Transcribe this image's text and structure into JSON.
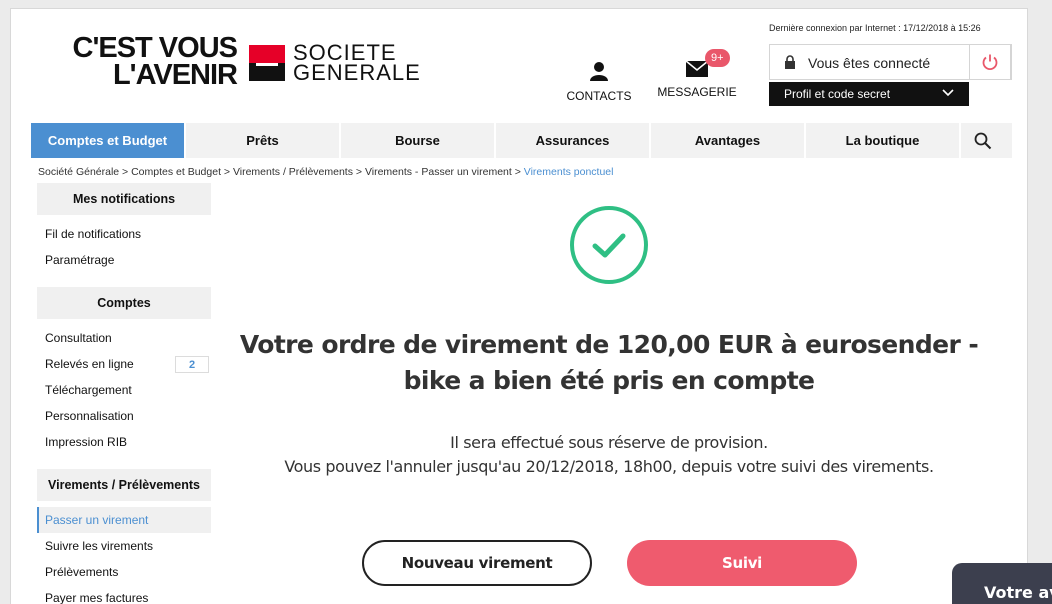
{
  "header": {
    "slogan_line1": "C'EST VOUS",
    "slogan_line2": "L'AVENIR",
    "brand_line1": "SOCIETE",
    "brand_line2": "GENERALE",
    "contacts_label": "CONTACTS",
    "messagerie_label": "MESSAGERIE",
    "messagerie_badge": "9+",
    "last_login": "Dernière connexion par Internet : 17/12/2018 à 15:26",
    "connected_label": "Vous êtes connecté",
    "profil_label": "Profil et code secret"
  },
  "nav": {
    "items": [
      "Comptes et Budget",
      "Prêts",
      "Bourse",
      "Assurances",
      "Avantages",
      "La boutique"
    ]
  },
  "breadcrumb": {
    "path": "Société Générale > Comptes et Budget > Virements / Prélèvements > Virements - Passer un virement > ",
    "current": "Virements ponctuel"
  },
  "sidebar": {
    "sections": [
      {
        "title": "Mes notifications",
        "items": [
          "Fil de notifications",
          "Paramétrage"
        ]
      },
      {
        "title": "Comptes",
        "items": [
          "Consultation",
          "Relevés en ligne",
          "Téléchargement",
          "Personnalisation",
          "Impression RIB"
        ],
        "releves_count": "2"
      },
      {
        "title": "Virements / Prélèvements",
        "items": [
          "Passer un virement",
          "Suivre les virements",
          "Prélèvements",
          "Payer mes factures"
        ]
      }
    ]
  },
  "main": {
    "title": "Votre ordre de virement de 120,00 EUR à eurosender - bike a bien été pris en compte",
    "sub_line1": "Il sera effectué sous réserve de provision.",
    "sub_line2": "Vous pouvez l'annuler jusqu'au 20/12/2018, 18h00, depuis votre suivi des virements.",
    "btn_new": "Nouveau virement",
    "btn_suivi": "Suivi"
  },
  "chat": {
    "label": "Votre av"
  },
  "colors": {
    "accent_blue": "#4b8fd1",
    "brand_red": "#e60028",
    "success_green": "#2fbf84",
    "button_pink": "#ef5b6e"
  }
}
